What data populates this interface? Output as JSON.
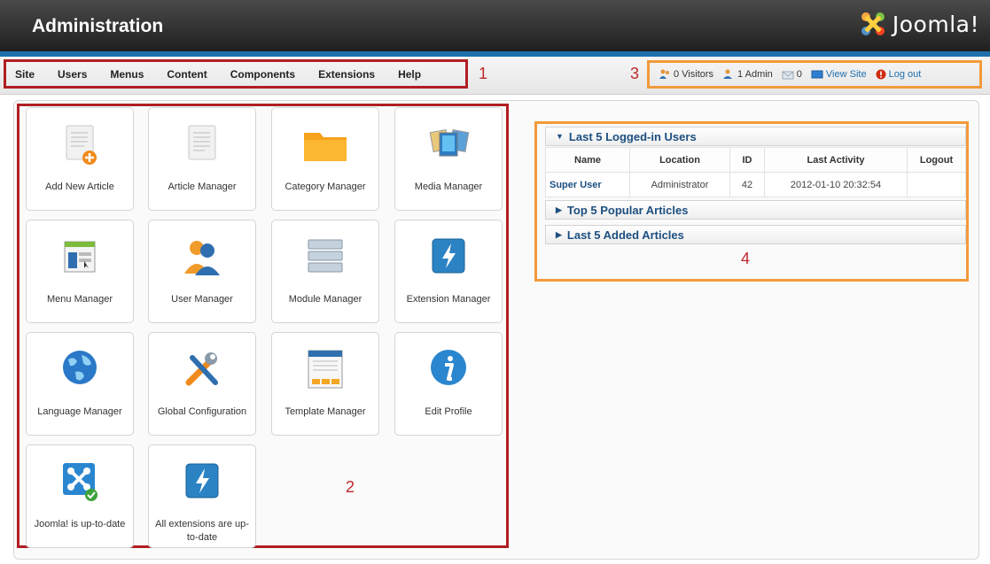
{
  "header": {
    "title": "Administration",
    "logo_text": "Joomla!"
  },
  "menu": {
    "items": [
      "Site",
      "Users",
      "Menus",
      "Content",
      "Components",
      "Extensions",
      "Help"
    ]
  },
  "status": {
    "visitors": "0 Visitors",
    "admin": "1 Admin",
    "messages": "0",
    "view_site": "View Site",
    "logout": "Log out"
  },
  "markers": {
    "m1": "1",
    "m2": "2",
    "m3": "3",
    "m4": "4"
  },
  "icons": [
    {
      "label": "Add New Article",
      "icon": "add-article-icon"
    },
    {
      "label": "Article Manager",
      "icon": "article-manager-icon"
    },
    {
      "label": "Category Manager",
      "icon": "folder-icon"
    },
    {
      "label": "Media Manager",
      "icon": "media-manager-icon"
    },
    {
      "label": "Menu Manager",
      "icon": "menu-manager-icon"
    },
    {
      "label": "User Manager",
      "icon": "user-manager-icon"
    },
    {
      "label": "Module Manager",
      "icon": "module-manager-icon"
    },
    {
      "label": "Extension Manager",
      "icon": "extension-manager-icon"
    },
    {
      "label": "Language Manager",
      "icon": "globe-icon"
    },
    {
      "label": "Global Configuration",
      "icon": "tools-icon"
    },
    {
      "label": "Template Manager",
      "icon": "template-manager-icon"
    },
    {
      "label": "Edit Profile",
      "icon": "info-icon"
    },
    {
      "label": "Joomla! is up-to-date",
      "icon": "joomla-update-icon"
    },
    {
      "label": "All extensions are up-to-date",
      "icon": "extension-update-icon"
    }
  ],
  "modules": {
    "logged_in": {
      "title": "Last 5 Logged-in Users",
      "columns": [
        "Name",
        "Location",
        "ID",
        "Last Activity",
        "Logout"
      ],
      "rows": [
        [
          "Super User",
          "Administrator",
          "42",
          "2012-01-10 20:32:54",
          ""
        ]
      ]
    },
    "popular": {
      "title": "Top 5 Popular Articles"
    },
    "added": {
      "title": "Last 5 Added Articles"
    }
  },
  "colors": {
    "header": "#2b2b2b",
    "accent": "#1d6fae",
    "annotation_red": "#b01e22",
    "annotation_orange": "#f39a3a"
  }
}
